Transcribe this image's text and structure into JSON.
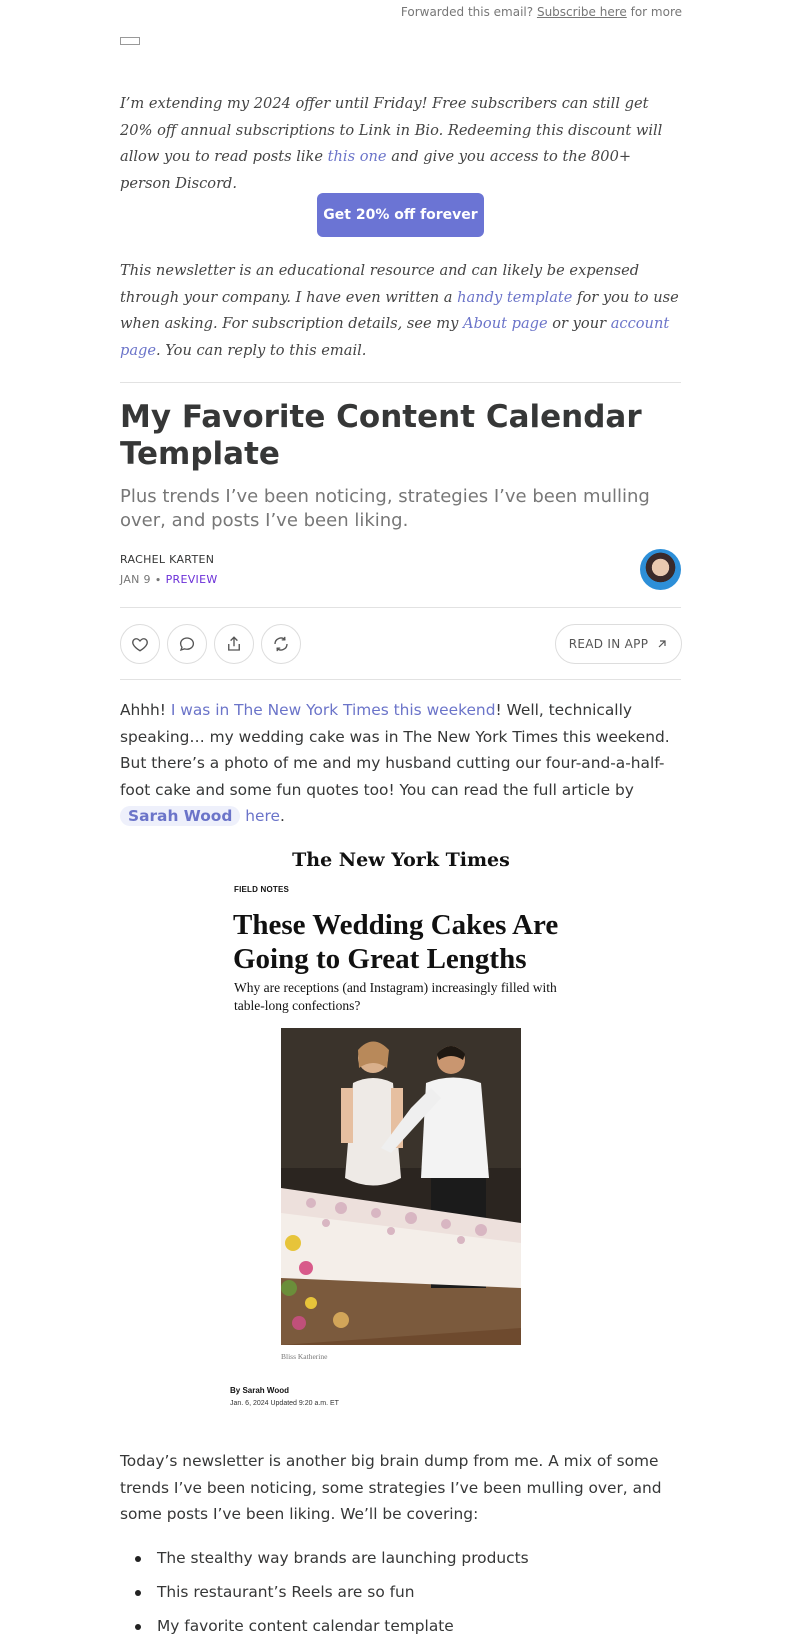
{
  "forward": {
    "prefix": "Forwarded this email?",
    "link": "Subscribe here",
    "suffix": "for more"
  },
  "intro": {
    "text_1": "I’m extending my 2024 offer until Friday! Free subscribers can still get 20% off annual subscriptions to Link in Bio. Redeeming this discount will allow you to read posts like ",
    "link_1": "this one",
    "text_2": " and give you access to the 800+ person Discord."
  },
  "cta": {
    "label": "Get 20% off forever"
  },
  "outro": {
    "text_1": "This newsletter is an educational resource and can likely be expensed through your company. I have even written a ",
    "link_1": "handy template",
    "text_2": " for you to use when asking. For subscription details, see my ",
    "link_2": "About page",
    "text_3": " or your ",
    "link_3": "account page",
    "text_4": ". You can reply to this email."
  },
  "post": {
    "title": "My Favorite Content Calendar Template",
    "subtitle": "Plus trends I’ve been noticing, strategies I’ve been mulling over, and posts I’ve been liking.",
    "author": "RACHEL KARTEN",
    "date": "JAN 9",
    "separator": "∙",
    "preview": "PREVIEW"
  },
  "actions": {
    "icons": [
      "heart-icon",
      "comment-icon",
      "share-icon",
      "restack-icon",
      "arrow-up-right-icon"
    ],
    "read_in_app": "READ IN APP"
  },
  "paragraph_1": {
    "text_1": "Ahhh! ",
    "link_1": "I was in The New York Times this weekend",
    "text_2": "! Well, technically speaking… my wedding cake was in The New York Times this weekend. But there’s a photo of me and my husband cutting our four-and-a-half-foot cake and some fun quotes too! You can read the full article by ",
    "mention": "Sarah Wood",
    "text_3": " ",
    "link_2": "here",
    "text_4": "."
  },
  "nyt_clip": {
    "masthead": "The New York Times",
    "kicker": "FIELD NOTES",
    "headline": "These Wedding Cakes Are Going to Great Lengths",
    "dek": "Why are receptions (and Instagram) increasingly filled with table-long confections?",
    "photo_credit": "Bliss Katherine",
    "byline": "By Sarah Wood",
    "dateline": "Jan. 6, 2024    Updated 9:20 a.m. ET"
  },
  "paragraph_2": {
    "text": "Today’s newsletter is another big brain dump from me. A mix of some trends I’ve been noticing, some strategies I’ve been mulling over, and some posts I’ve been liking. We’ll be covering:"
  },
  "list_items": [
    "The stealthy way brands are launching products",
    "This restaurant’s Reels are so fun",
    "My favorite content calendar template"
  ],
  "colors": {
    "accent": "#6b74d4",
    "link": "#6b74c9",
    "preview": "#6b2fd8",
    "text": "#363737"
  }
}
